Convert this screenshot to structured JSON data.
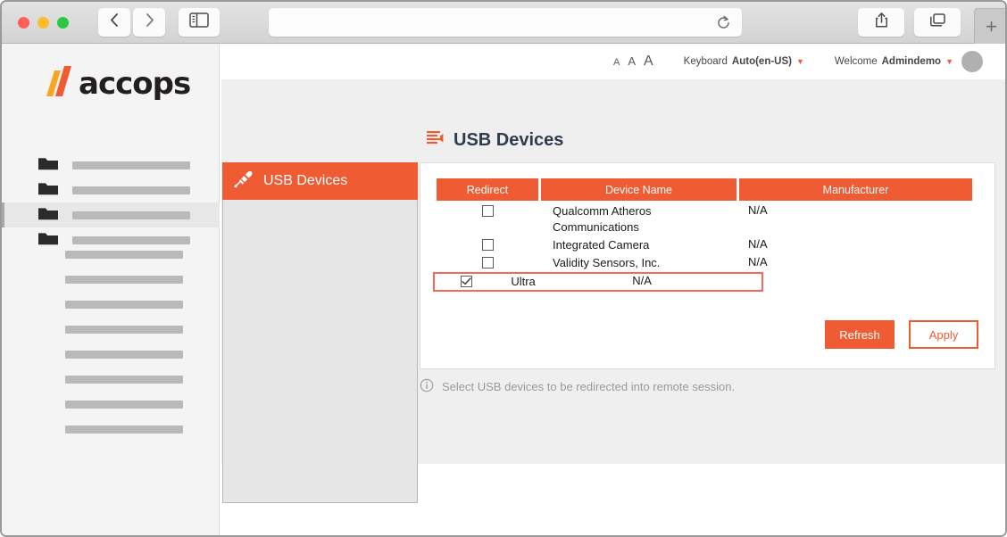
{
  "browser": {
    "traffic_lights": [
      "close",
      "minimize",
      "zoom"
    ],
    "back_icon": "chevron-left-icon",
    "forward_icon": "chevron-right-icon",
    "sidebar_icon": "sidebar-toggle-icon",
    "url_value": "",
    "url_placeholder": "",
    "reload_icon": "reload-icon",
    "share_icon": "share-icon",
    "tabs_icon": "tab-overview-icon",
    "new_tab_label": "+"
  },
  "app_nav": {
    "logo_text": "accops",
    "logo_slash_colors": [
      "#f6a623",
      "#ef5b33"
    ],
    "folder_items": [
      {
        "icon": "folder-icon",
        "active": false
      },
      {
        "icon": "folder-icon",
        "active": false
      },
      {
        "icon": "folder-icon",
        "active": true
      },
      {
        "icon": "folder-icon",
        "active": false
      }
    ],
    "placeholder_bar_count": 8
  },
  "topbar": {
    "font_size_small": "A",
    "font_size_medium": "A",
    "font_size_large": "A",
    "keyboard_label": "Keyboard",
    "keyboard_value": "Auto(en-US)",
    "keyboard_caret": "caret-down-icon",
    "welcome_label": "Welcome",
    "welcome_user": "Admindemo",
    "welcome_caret": "caret-down-icon",
    "avatar": "user-avatar"
  },
  "page": {
    "title": "USB Devices",
    "title_icon": "list-lines-icon",
    "left_tab": {
      "label": "USB Devices",
      "icon": "usb-plug-icon"
    },
    "info_text": "Select USB devices to be redirected into remote session.",
    "info_icon": "info-circle-icon"
  },
  "table": {
    "columns": [
      "Redirect",
      "Device Name",
      "Manufacturer"
    ],
    "rows": [
      {
        "checked": false,
        "device": "Qualcomm Atheros Communications",
        "manufacturer": "N/A",
        "highlighted": false
      },
      {
        "checked": false,
        "device": "Integrated Camera",
        "manufacturer": "N/A",
        "highlighted": false
      },
      {
        "checked": false,
        "device": "Validity Sensors, Inc.",
        "manufacturer": "N/A",
        "highlighted": false
      },
      {
        "checked": true,
        "device": "Ultra",
        "manufacturer": "N/A",
        "highlighted": true
      }
    ]
  },
  "actions": {
    "refresh_label": "Refresh",
    "apply_label": "Apply"
  },
  "colors": {
    "accent": "#ef5b33",
    "highlight_outline": "#f16a5c",
    "title_text": "#303c4c",
    "shell_bg": "#efefef"
  }
}
